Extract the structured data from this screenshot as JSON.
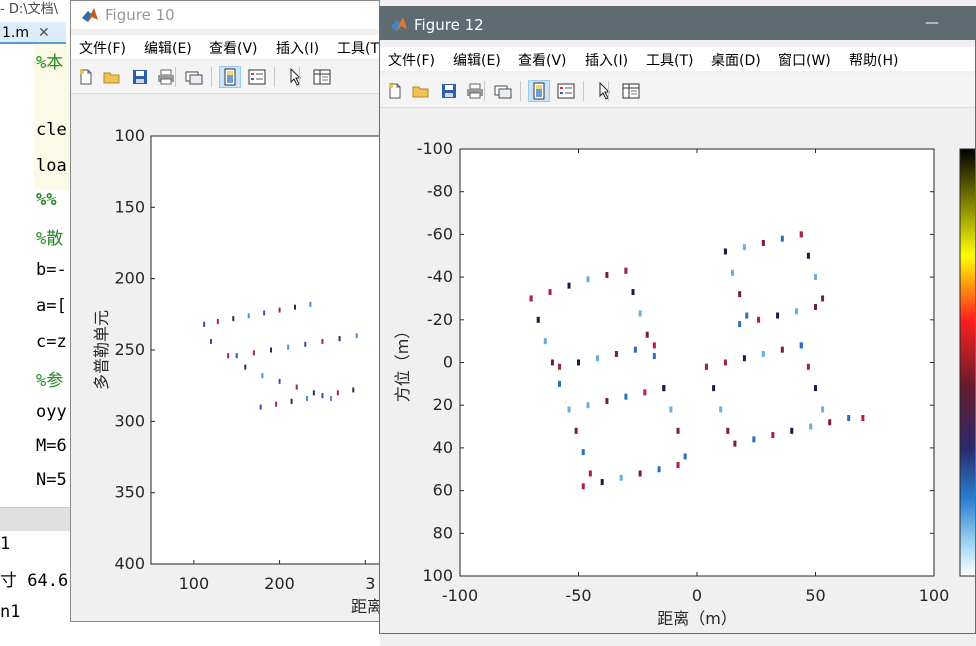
{
  "editor": {
    "title": "- D:\\文档\\",
    "tab_label": "1.m",
    "tab_close": "✕",
    "code_lines": [
      "%本",
      "cle",
      "loa",
      "%%",
      "%散",
      "b=-",
      "a=[",
      "c=z",
      "%参",
      "oyy",
      "M=6",
      "N=5"
    ],
    "cmd_lines": [
      "1",
      "寸 64.6",
      "n1"
    ]
  },
  "figure10": {
    "title": "Figure 10",
    "menu": [
      "文件(F)",
      "编辑(E)",
      "查看(V)",
      "插入(I)",
      "工具(T"
    ],
    "plot": {
      "ylabel": "多普勒单元",
      "xlabel": "距离",
      "yticks": [
        "100",
        "150",
        "200",
        "250",
        "300",
        "350",
        "400"
      ],
      "xticks": [
        "100",
        "200",
        "3"
      ]
    }
  },
  "figure12": {
    "title": "Figure 12",
    "minimize": "—",
    "menu": [
      "文件(F)",
      "编辑(E)",
      "查看(V)",
      "插入(I)",
      "工具(T)",
      "桌面(D)",
      "窗口(W)",
      "帮助(H)"
    ],
    "plot": {
      "ylabel": "方位（m）",
      "xlabel": "距离（m）",
      "yticks": [
        "-100",
        "-80",
        "-60",
        "-40",
        "-20",
        "0",
        "20",
        "40",
        "60",
        "80",
        "100"
      ],
      "xticks": [
        "-100",
        "-50",
        "0",
        "50",
        "100"
      ]
    }
  },
  "chart_data": [
    {
      "type": "scatter",
      "title": "",
      "xlabel": "距离",
      "ylabel": "多普勒单元",
      "xlim": [
        50,
        330
      ],
      "ylim": [
        100,
        400
      ],
      "y_reversed": true,
      "grid": false,
      "description_of_points": "four squares scatterer arrangement, sheared",
      "x": [
        112,
        128,
        146,
        164,
        182,
        200,
        218,
        236,
        120,
        140,
        160,
        180,
        200,
        220,
        240,
        260,
        150,
        170,
        190,
        210,
        230,
        250,
        270,
        290,
        178,
        196,
        214,
        232,
        250,
        268,
        286
      ],
      "y": [
        232,
        230,
        228,
        226,
        224,
        222,
        220,
        218,
        244,
        254,
        262,
        268,
        272,
        276,
        280,
        284,
        254,
        252,
        250,
        248,
        246,
        244,
        242,
        240,
        290,
        288,
        286,
        284,
        282,
        280,
        278
      ]
    },
    {
      "type": "scatter",
      "title": "",
      "xlabel": "距离（m）",
      "ylabel": "方位（m）",
      "xlim": [
        -100,
        100
      ],
      "ylim": [
        -100,
        100
      ],
      "y_reversed": true,
      "grid": false,
      "colormap": "jet-like colorbar at right",
      "x": [
        -70,
        -62,
        -54,
        -46,
        -38,
        -30,
        -70,
        -67,
        -64,
        -61,
        -58,
        -30,
        -27,
        -24,
        -21,
        -18,
        -58,
        -50,
        -42,
        -34,
        -26,
        -18,
        -54,
        -46,
        -38,
        -30,
        -22,
        -14,
        -54,
        -51,
        -48,
        -45,
        -14,
        -11,
        -8,
        -5,
        -48,
        -40,
        -32,
        -24,
        -16,
        -8,
        12,
        20,
        28,
        36,
        44,
        12,
        15,
        18,
        21,
        44,
        47,
        50,
        53,
        18,
        26,
        34,
        42,
        50,
        4,
        12,
        20,
        28,
        36,
        44,
        4,
        7,
        10,
        13,
        44,
        47,
        50,
        53,
        16,
        24,
        32,
        40,
        48,
        56,
        64,
        70
      ],
      "y": [
        -30,
        -33,
        -36,
        -39,
        -41,
        -43,
        -30,
        -20,
        -10,
        0,
        10,
        -43,
        -33,
        -23,
        -13,
        -3,
        2,
        0,
        -2,
        -4,
        -6,
        -8,
        22,
        20,
        18,
        16,
        14,
        12,
        22,
        32,
        42,
        52,
        12,
        22,
        32,
        44,
        58,
        56,
        54,
        52,
        50,
        48,
        -52,
        -54,
        -56,
        -58,
        -60,
        -52,
        -42,
        -32,
        -22,
        -60,
        -50,
        -40,
        -30,
        -18,
        -20,
        -22,
        -24,
        -26,
        2,
        0,
        -2,
        -4,
        -6,
        -8,
        2,
        12,
        22,
        32,
        -8,
        2,
        12,
        22,
        38,
        36,
        34,
        32,
        30,
        28,
        26,
        26
      ]
    }
  ]
}
